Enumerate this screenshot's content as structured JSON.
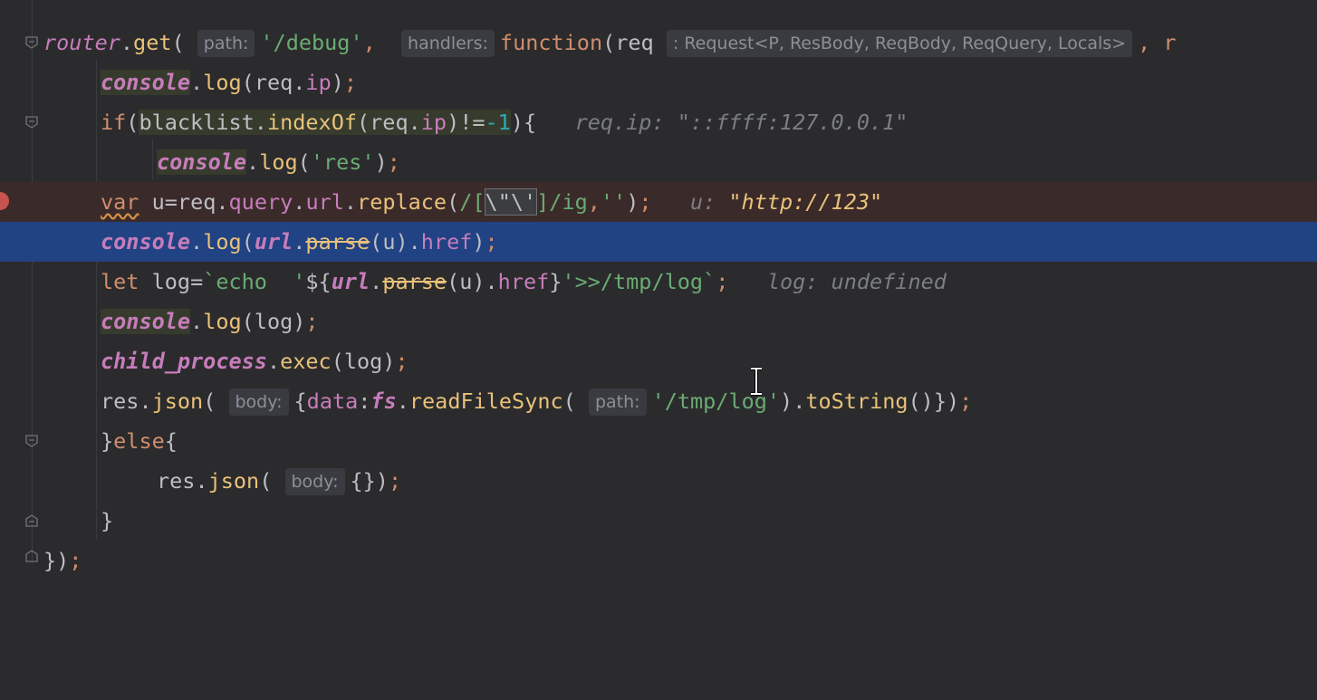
{
  "editor": {
    "lines": [
      {
        "id": "l1"
      },
      {
        "id": "l2"
      }
    ],
    "t": {
      "router": "router",
      "get": "get",
      "path_hint": "path:",
      "debug_str": "'/debug'",
      "handlers_hint": "handlers:",
      "function_kw": "function",
      "req": "req",
      "req_type_hint": ": Request<P, ResBody, ReqBody, ReqQuery, Locals>",
      "trailing_r": "r",
      "console": "console",
      "log": "log",
      "ip": "ip",
      "if_kw": "if",
      "blacklist": "blacklist",
      "indexOf": "indexOf",
      "minus_one": "-1",
      "req_ip_value": "req.ip: \"::ffff:127.0.0.1\"",
      "res_str": "'res'",
      "var_kw": "var",
      "u": "u",
      "query": "query",
      "url": "url",
      "replace": "replace",
      "regex_a": "/[",
      "regex_b": "\\\"\\'",
      "regex_c": "]/ig",
      "empty_str": "''",
      "u_value_label": "u: ",
      "u_value": "\"http://123\"",
      "parse": "parse",
      "href": "href",
      "let_kw": "let",
      "log_var": "log",
      "tpl_a": "`echo  '",
      "tpl_open": "${",
      "tpl_close": "}",
      "tpl_b": "'>>/tmp/log`",
      "log_value": "log: undefined",
      "child_process": "child_process",
      "exec": "exec",
      "res": "res",
      "json": "json",
      "body_hint": "body:",
      "data": "data",
      "fs": "fs",
      "readFileSync": "readFileSync",
      "tmp_log_str": "'/tmp/log'",
      "toString": "toString",
      "else_kw": "else",
      "close_brace": "}",
      "close_all": "});"
    }
  },
  "colors": {
    "background": "#2b2b2d",
    "current_line": "#214283",
    "breakpoint_line": "#3b2a2a",
    "breakpoint": "#c75450"
  },
  "icons": [
    "fold-marker-icon",
    "breakpoint-icon",
    "text-cursor-icon"
  ]
}
